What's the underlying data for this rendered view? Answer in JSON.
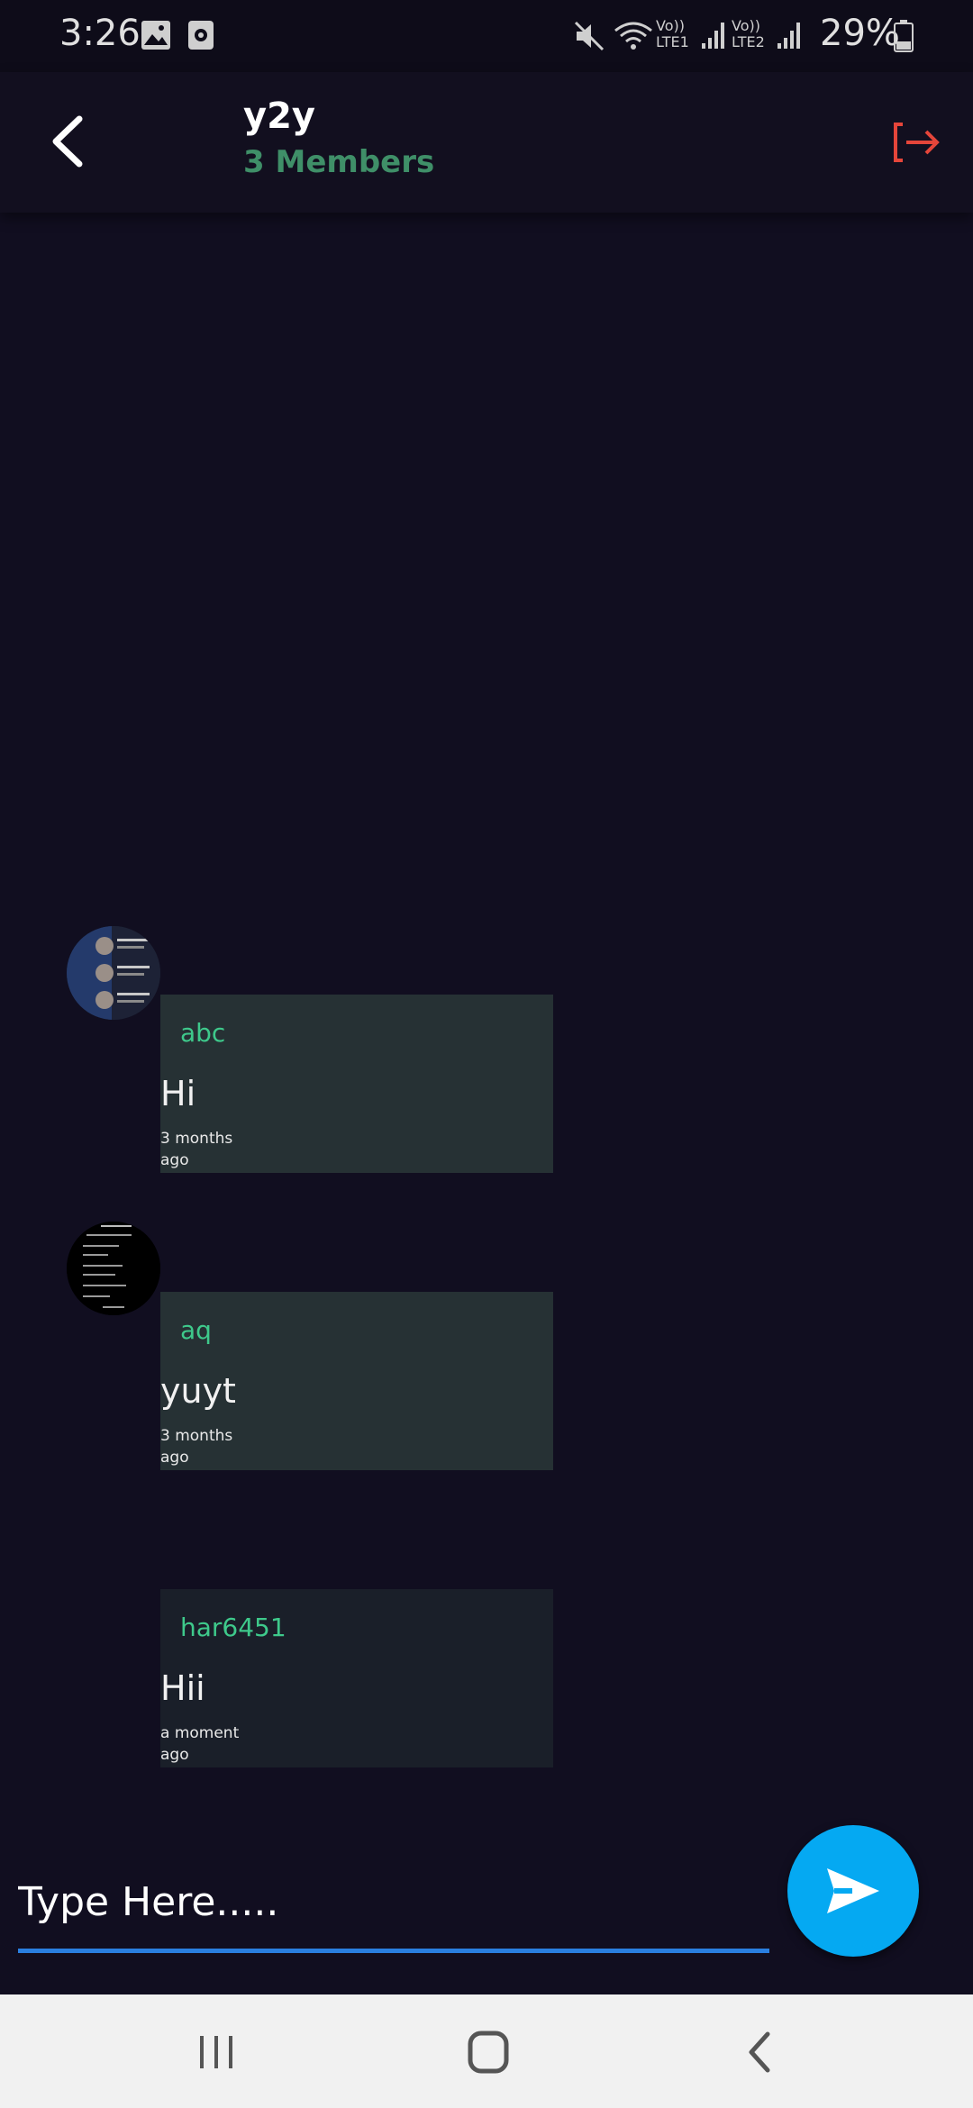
{
  "status_bar": {
    "time": "3:26",
    "battery_percent": "29%",
    "sim1_label": "Vo)) LTE1",
    "sim2_label": "Vo)) LTE2",
    "icons": [
      "gallery-icon",
      "screen-recorder-icon",
      "mute-icon",
      "wifi-icon",
      "signal-icon",
      "battery-icon"
    ]
  },
  "header": {
    "title": "y2y",
    "subtitle": "3 Members",
    "back_icon": "back-arrow-icon",
    "exit_icon": "exit-group-icon"
  },
  "messages": [
    {
      "sender": "abc",
      "text": "Hi",
      "time": "3 months ago",
      "has_avatar": true
    },
    {
      "sender": "aq",
      "text": "yuyt",
      "time": "3 months ago",
      "has_avatar": true
    },
    {
      "sender": "har6451",
      "text": "Hii",
      "time": "a moment ago",
      "has_avatar": false
    }
  ],
  "composer": {
    "placeholder": "Type Here.....",
    "send_icon": "send-icon"
  },
  "colors": {
    "background": "#110e20",
    "accent_green": "#3ec98b",
    "exit_red": "#e5453a",
    "send_blue": "#05a9f2",
    "input_underline": "#2a7fe0",
    "bubble_other": "#263134",
    "bubble_mine": "#1a1f29"
  },
  "nav_bar": {
    "icons": [
      "recent-apps-icon",
      "home-icon",
      "system-back-icon"
    ]
  }
}
